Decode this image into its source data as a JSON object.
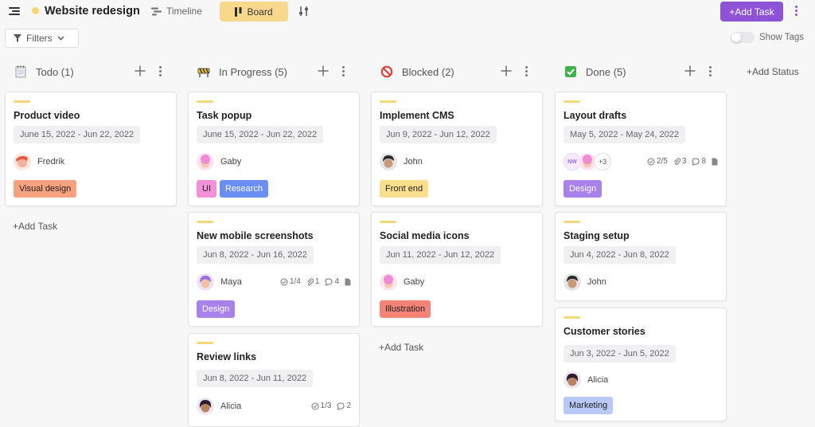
{
  "header": {
    "title": "Website redesign",
    "timeline_label": "Timeline",
    "board_label": "Board",
    "add_task_label": "+Add Task"
  },
  "filters": {
    "label": "Filters"
  },
  "show_tags": {
    "label": "Show Tags",
    "enabled": false
  },
  "add_status_label": "+Add Status",
  "add_task_column_label": "+Add Task",
  "colors": {
    "accent": "#8e52d6",
    "board_active": "#f8d98c",
    "card_bar": "#f7d774"
  },
  "columns": [
    {
      "title": "Todo (1)",
      "icon": "notepad-icon",
      "cards": [
        {
          "title": "Product video",
          "date": "June 15, 2022 - Jun 22, 2022",
          "assignee": "Fredrik",
          "tags": [
            {
              "label": "Visual design",
              "color": "#f7a27e"
            }
          ]
        }
      ]
    },
    {
      "title": "In Progress (5)",
      "icon": "construction-icon",
      "cards": [
        {
          "title": "Task popup",
          "date": "June 15, 2022 - Jun 22, 2022",
          "assignee": "Gaby",
          "tags": [
            {
              "label": "UI",
              "color": "#f291d8"
            },
            {
              "label": "Research",
              "color": "#6b8ef2"
            }
          ]
        },
        {
          "title": "New mobile screenshots",
          "date": "Jun 8, 2022 - Jun 16, 2022",
          "assignee": "Maya",
          "meta": {
            "subtasks": "1/4",
            "attachments": "1",
            "comments": "4"
          },
          "tags": [
            {
              "label": "Design",
              "color": "#a881ea"
            }
          ]
        },
        {
          "title": "Review links",
          "date": "Jun 8, 2022 - Jun 11, 2022",
          "assignee": "Alicia",
          "meta": {
            "subtasks": "1/3",
            "comments": "2"
          },
          "tags": []
        }
      ]
    },
    {
      "title": "Blocked (2)",
      "icon": "prohibited-icon",
      "cards": [
        {
          "title": "Implement CMS",
          "date": "Jun 9, 2022 - Jun 12, 2022",
          "assignee": "John",
          "tags": [
            {
              "label": "Front end",
              "color": "#f8de8d"
            }
          ]
        },
        {
          "title": "Social media icons",
          "date": "Jun 11, 2022 - Jun 12, 2022",
          "assignee": "Gaby",
          "tags": [
            {
              "label": "Illustration",
              "color": "#f58277"
            }
          ]
        }
      ]
    },
    {
      "title": "Done (5)",
      "icon": "check-box-icon",
      "cards": [
        {
          "title": "Layout drafts",
          "date": "May 5, 2022 - May 24, 2022",
          "avatars_initials": "NW",
          "avatars_more": "+3",
          "meta": {
            "subtasks": "2/5",
            "attachments": "3",
            "comments": "8"
          },
          "tags": [
            {
              "label": "Design",
              "color": "#a881ea"
            }
          ]
        },
        {
          "title": "Staging setup",
          "date": "Jun 4, 2022 - Jun 8, 2022",
          "assignee": "John",
          "tags": []
        },
        {
          "title": "Customer stories",
          "date": "Jun 3, 2022 - Jun 5, 2022",
          "assignee": "Alicia",
          "tags": [
            {
              "label": "Marketing",
              "color": "#b9c9f7"
            }
          ]
        }
      ]
    }
  ]
}
